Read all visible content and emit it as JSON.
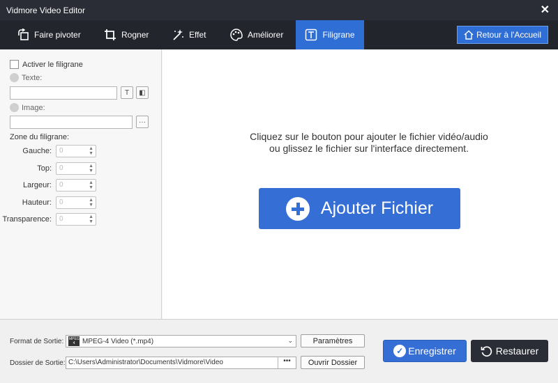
{
  "app": {
    "title": "Vidmore Video Editor"
  },
  "tabs": [
    {
      "label": "Faire pivoter",
      "icon": "rotate-icon"
    },
    {
      "label": "Rogner",
      "icon": "crop-icon"
    },
    {
      "label": "Effet",
      "icon": "effect-wand-icon"
    },
    {
      "label": "Améliorer",
      "icon": "palette-icon"
    },
    {
      "label": "Filigrane",
      "icon": "watermark-text-icon",
      "active": true
    }
  ],
  "home_button": {
    "label": "Retour à l'Accueil"
  },
  "watermark": {
    "enable_label": "Activer le filigrane",
    "text_label": "Texte:",
    "image_label": "Image:",
    "zone_label": "Zone du filigrane:",
    "fields": [
      {
        "label": "Gauche:",
        "value": "0"
      },
      {
        "label": "Top:",
        "value": "0"
      },
      {
        "label": "Largeur:",
        "value": "0"
      },
      {
        "label": "Hauteur:",
        "value": "0"
      },
      {
        "label": "Transparence:",
        "value": "0"
      }
    ]
  },
  "main": {
    "hint": "Cliquez sur le bouton pour ajouter le fichier vidéo/audio ou glissez le fichier sur l'interface directement.",
    "add_label": "Ajouter Fichier"
  },
  "output": {
    "format_label": "Format de Sortie:",
    "format_value": "MPEG-4 Video (*.mp4)",
    "format_badge": "MPEG 4",
    "folder_label": "Dossier de Sortie:",
    "folder_value": "C:\\Users\\Administrator\\Documents\\Vidmore\\Video",
    "settings_label": "Paramètres",
    "open_folder_label": "Ouvrir Dossier",
    "save_label": "Enregistrer",
    "restore_label": "Restaurer"
  },
  "colors": {
    "accent": "#356fd6",
    "dark": "#23252d",
    "titlebar": "#2b2d36"
  }
}
